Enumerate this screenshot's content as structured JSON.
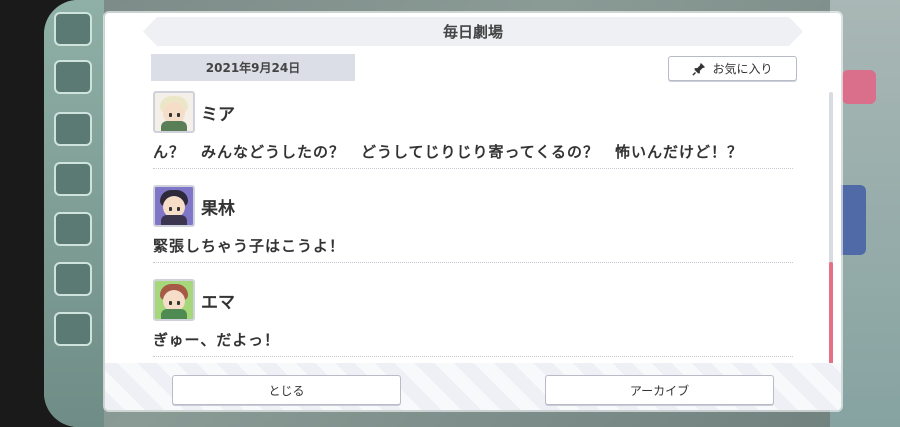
{
  "dialog": {
    "title": "毎日劇場",
    "date": "2021年9月24日",
    "favorite_label": "お気に入り"
  },
  "entries": [
    {
      "speaker": "ミア",
      "text": "ん？　みんなどうしたの？　どうしてじりじり寄ってくるの？　怖いんだけど！？",
      "avatar": "mia-avatar"
    },
    {
      "speaker": "果林",
      "text": "緊張しちゃう子はこうよ！",
      "avatar": "karin-avatar"
    },
    {
      "speaker": "エマ",
      "text": "ぎゅー、だよっ！",
      "avatar": "emma-avatar"
    }
  ],
  "footer": {
    "close_label": "とじる",
    "archive_label": "アーカイブ"
  },
  "colors": {
    "accent": "#e46f86",
    "date_bg": "#dcdee7"
  }
}
